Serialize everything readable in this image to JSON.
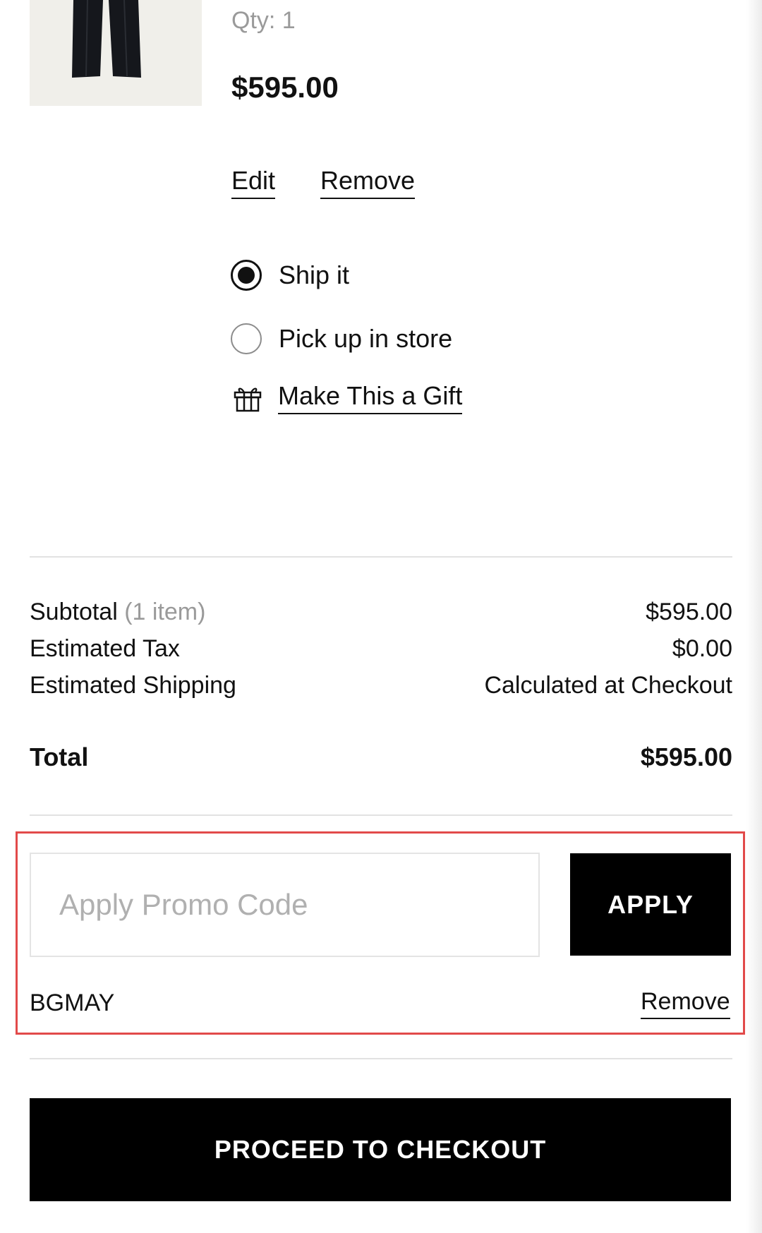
{
  "product": {
    "qty_label": "Qty: 1",
    "price": "$595.00",
    "edit_label": "Edit",
    "remove_label": "Remove"
  },
  "fulfillment": {
    "ship_label": "Ship it",
    "pickup_label": "Pick up in store",
    "selected": "ship",
    "gift_label": "Make This a Gift"
  },
  "summary": {
    "subtotal_label": "Subtotal",
    "subtotal_count": "(1 item)",
    "subtotal_value": "$595.00",
    "tax_label": "Estimated Tax",
    "tax_value": "$0.00",
    "shipping_label": "Estimated Shipping",
    "shipping_value": "Calculated at Checkout",
    "total_label": "Total",
    "total_value": "$595.00"
  },
  "promo": {
    "placeholder": "Apply Promo Code",
    "value": "",
    "apply_label": "APPLY",
    "applied_code": "BGMAY",
    "remove_label": "Remove"
  },
  "checkout": {
    "button_label": "PROCEED TO CHECKOUT"
  },
  "colors": {
    "highlight_border": "#e24a4a",
    "button_bg": "#000000",
    "muted_text": "#9a9a9a"
  }
}
